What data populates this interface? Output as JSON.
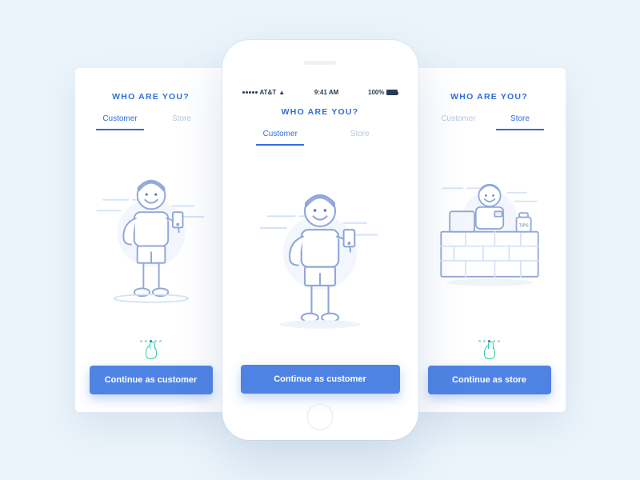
{
  "colors": {
    "accent": "#2f6fe0",
    "button": "#4f83e3",
    "inactive": "#b9c7dc",
    "mint": "#36c99a"
  },
  "status": {
    "carrier": "AT&T",
    "time": "9:41 AM",
    "battery_pct": "100%"
  },
  "title": "WHO ARE YOU?",
  "tabs": {
    "customer": "Customer",
    "store": "Store"
  },
  "buttons": {
    "customer": "Continue as customer",
    "store": "Continue as store"
  },
  "store_illus": {
    "tips_label": "TIPS"
  },
  "screens": [
    {
      "id": "left",
      "active_tab": "customer",
      "has_statusbar": false
    },
    {
      "id": "center",
      "active_tab": "customer",
      "has_statusbar": true
    },
    {
      "id": "right",
      "active_tab": "store",
      "has_statusbar": false
    }
  ]
}
